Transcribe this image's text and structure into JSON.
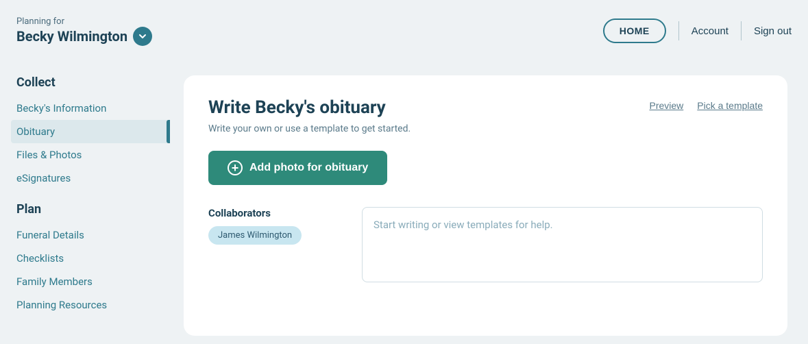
{
  "brand": {
    "subtitle": "Planning for",
    "name": "Becky Wilmington"
  },
  "topNav": {
    "home_label": "HOME",
    "account_label": "Account",
    "signout_label": "Sign out"
  },
  "sidebar": {
    "collect_title": "Collect",
    "collect_items": [
      {
        "label": "Becky's Information",
        "active": false
      },
      {
        "label": "Obituary",
        "active": true
      },
      {
        "label": "Files & Photos",
        "active": false
      },
      {
        "label": "eSignatures",
        "active": false
      }
    ],
    "plan_title": "Plan",
    "plan_items": [
      {
        "label": "Funeral Details",
        "active": false
      },
      {
        "label": "Checklists",
        "active": false
      },
      {
        "label": "Family Members",
        "active": false
      },
      {
        "label": "Planning Resources",
        "active": false
      }
    ]
  },
  "card": {
    "title": "Write Becky's obituary",
    "subtitle": "Write your own or use a template to get started.",
    "add_photo_label": "Add photo for obituary",
    "preview_label": "Preview",
    "pick_template_label": "Pick a template",
    "collaborators_title": "Collaborators",
    "collaborator_name": "James Wilmington",
    "writing_placeholder": "Start writing or view templates for help."
  }
}
